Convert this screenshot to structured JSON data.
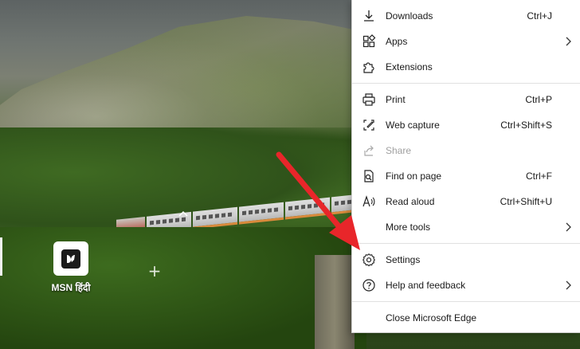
{
  "background": {
    "tile": {
      "label": "MSN हिंदी",
      "icon": "msn-butterfly-icon"
    },
    "add_icon": "plus-icon"
  },
  "menu": {
    "items": [
      {
        "label": "Downloads",
        "shortcut": "Ctrl+J",
        "icon": "download-icon",
        "submenu": false,
        "disabled": false
      },
      {
        "label": "Apps",
        "shortcut": "",
        "icon": "apps-icon",
        "submenu": true,
        "disabled": false
      },
      {
        "label": "Extensions",
        "shortcut": "",
        "icon": "puzzle-icon",
        "submenu": false,
        "disabled": false
      },
      {
        "label": "Print",
        "shortcut": "Ctrl+P",
        "icon": "printer-icon",
        "submenu": false,
        "disabled": false
      },
      {
        "label": "Web capture",
        "shortcut": "Ctrl+Shift+S",
        "icon": "web-capture-icon",
        "submenu": false,
        "disabled": false
      },
      {
        "label": "Share",
        "shortcut": "",
        "icon": "share-icon",
        "submenu": false,
        "disabled": true
      },
      {
        "label": "Find on page",
        "shortcut": "Ctrl+F",
        "icon": "find-icon",
        "submenu": false,
        "disabled": false
      },
      {
        "label": "Read aloud",
        "shortcut": "Ctrl+Shift+U",
        "icon": "read-aloud-icon",
        "submenu": false,
        "disabled": false
      },
      {
        "label": "More tools",
        "shortcut": "",
        "icon": "",
        "submenu": true,
        "disabled": false
      },
      {
        "label": "Settings",
        "shortcut": "",
        "icon": "gear-icon",
        "submenu": false,
        "disabled": false
      },
      {
        "label": "Help and feedback",
        "shortcut": "",
        "icon": "help-icon",
        "submenu": true,
        "disabled": false
      },
      {
        "label": "Close Microsoft Edge",
        "shortcut": "",
        "icon": "",
        "submenu": false,
        "disabled": false
      }
    ]
  },
  "colors": {
    "annotation_arrow": "#e8262a",
    "disabled_text": "#a0a0a0",
    "menu_background": "#ffffff"
  }
}
